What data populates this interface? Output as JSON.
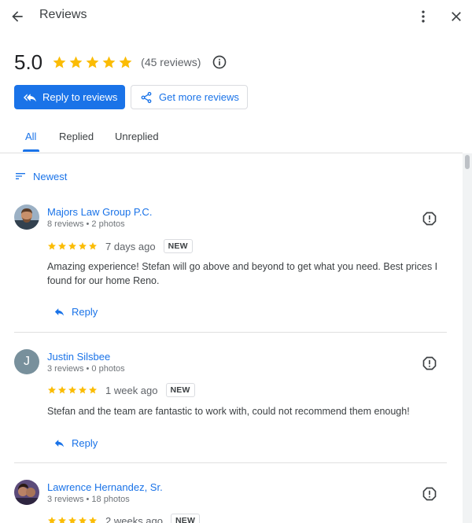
{
  "header": {
    "title": "Reviews",
    "back_icon": "arrow-left-icon",
    "more_icon": "more-vert-icon",
    "close_icon": "close-icon"
  },
  "summary": {
    "score": "5.0",
    "stars": 5,
    "count_label": "(45 reviews)",
    "info_icon": "info-icon"
  },
  "actions": {
    "reply_label": "Reply to reviews",
    "get_more_label": "Get more reviews"
  },
  "tabs": [
    {
      "label": "All",
      "active": true
    },
    {
      "label": "Replied",
      "active": false
    },
    {
      "label": "Unreplied",
      "active": false
    }
  ],
  "sort": {
    "label": "Newest"
  },
  "reviews": [
    {
      "name": "Majors Law Group P.C.",
      "meta": "8 reviews • 2 photos",
      "stars": 5,
      "time": "7 days ago",
      "badge": "NEW",
      "text": "Amazing experience! Stefan will go above and beyond to get what you need. Best prices I found for our home Reno.",
      "reply_label": "Reply",
      "avatar": "photo"
    },
    {
      "name": "Justin Silsbee",
      "meta": "3 reviews • 0 photos",
      "stars": 5,
      "time": "1 week ago",
      "badge": "NEW",
      "text": "Stefan and the team are fantastic to work with, could not recommend them enough!",
      "reply_label": "Reply",
      "avatar": "J"
    },
    {
      "name": "Lawrence Hernandez, Sr.",
      "meta": "3 reviews • 18 photos",
      "stars": 5,
      "time": "2 weeks ago",
      "badge": "NEW",
      "avatar": "photo"
    }
  ],
  "colors": {
    "accent": "#1a73e8",
    "star": "#fbbc04",
    "text": "#3c4043"
  }
}
